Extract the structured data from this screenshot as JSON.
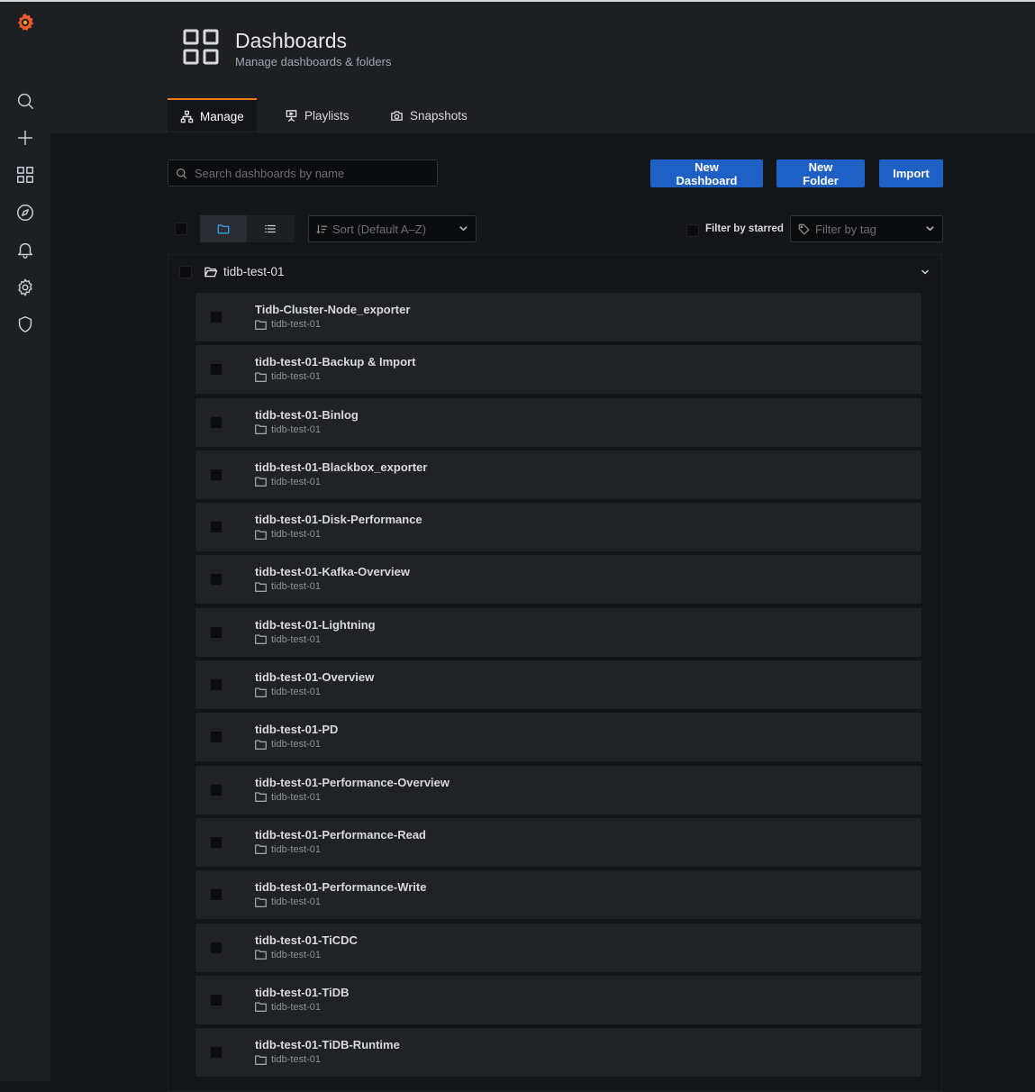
{
  "header": {
    "title": "Dashboards",
    "subtitle": "Manage dashboards & folders"
  },
  "sidebar": {
    "items": [
      {
        "name": "grafana-logo",
        "interactable": true
      },
      {
        "name": "search-icon"
      },
      {
        "name": "plus-icon"
      },
      {
        "name": "dashboards-icon"
      },
      {
        "name": "explore-icon"
      },
      {
        "name": "alerting-bell-icon"
      },
      {
        "name": "settings-gear-icon"
      },
      {
        "name": "shield-icon"
      }
    ]
  },
  "tabs": [
    {
      "label": "Manage",
      "active": true,
      "icon": "sitemap-icon"
    },
    {
      "label": "Playlists",
      "active": false,
      "icon": "presentation-icon"
    },
    {
      "label": "Snapshots",
      "active": false,
      "icon": "camera-icon"
    }
  ],
  "toolbar": {
    "search_placeholder": "Search dashboards by name",
    "new_dashboard_label": "New Dashboard",
    "new_folder_label": "New Folder",
    "import_label": "Import",
    "sort_label": "Sort (Default A–Z)",
    "filter_starred_label": "Filter by starred",
    "filter_tag_placeholder": "Filter by tag"
  },
  "colors": {
    "accent": "#1f60c4",
    "tab_active_border": "#eb7b18",
    "logo": "#f05a28"
  },
  "folder": {
    "name": "tidb-test-01",
    "expanded": true
  },
  "dashboards": [
    {
      "title": "Tidb-Cluster-Node_exporter",
      "folder": "tidb-test-01"
    },
    {
      "title": "tidb-test-01-Backup & Import",
      "folder": "tidb-test-01"
    },
    {
      "title": "tidb-test-01-Binlog",
      "folder": "tidb-test-01"
    },
    {
      "title": "tidb-test-01-Blackbox_exporter",
      "folder": "tidb-test-01"
    },
    {
      "title": "tidb-test-01-Disk-Performance",
      "folder": "tidb-test-01"
    },
    {
      "title": "tidb-test-01-Kafka-Overview",
      "folder": "tidb-test-01"
    },
    {
      "title": "tidb-test-01-Lightning",
      "folder": "tidb-test-01"
    },
    {
      "title": "tidb-test-01-Overview",
      "folder": "tidb-test-01"
    },
    {
      "title": "tidb-test-01-PD",
      "folder": "tidb-test-01"
    },
    {
      "title": "tidb-test-01-Performance-Overview",
      "folder": "tidb-test-01"
    },
    {
      "title": "tidb-test-01-Performance-Read",
      "folder": "tidb-test-01"
    },
    {
      "title": "tidb-test-01-Performance-Write",
      "folder": "tidb-test-01"
    },
    {
      "title": "tidb-test-01-TiCDC",
      "folder": "tidb-test-01"
    },
    {
      "title": "tidb-test-01-TiDB",
      "folder": "tidb-test-01"
    },
    {
      "title": "tidb-test-01-TiDB-Runtime",
      "folder": "tidb-test-01"
    }
  ]
}
